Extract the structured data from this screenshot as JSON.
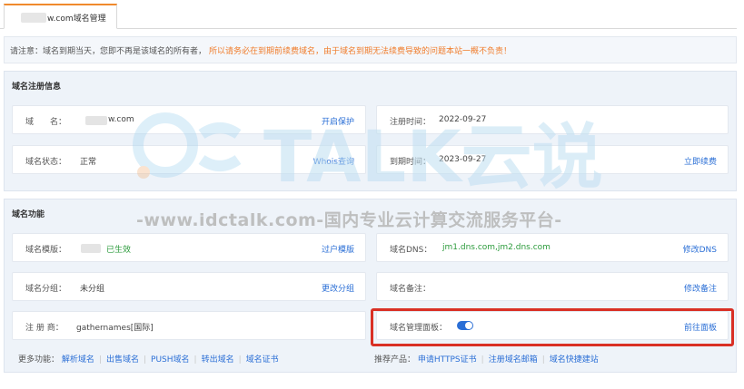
{
  "tab": {
    "label": "w.com域名管理"
  },
  "notice": {
    "text_grey": "请注意：域名到期当天，您即不再是该域名的所有者，",
    "text_orange": "所以请务必在到期前续费域名，由于域名到期无法续费导致的问题本站一概不负责！"
  },
  "registration": {
    "title": "域名注册信息",
    "domain_label": "域　　名：",
    "domain_value": "w.com",
    "domain_action": "开启保护",
    "reg_time_label": "注册时间：",
    "reg_time_value": "2022-09-27",
    "status_label": "域名状态：",
    "status_value": "正常",
    "status_action": "Whois查询",
    "expire_label": "到期时间：",
    "expire_value": "2023-09-27",
    "expire_action": "立即续费"
  },
  "functions": {
    "title": "域名功能",
    "template_label": "域名模版：",
    "template_status": "已生效",
    "template_action": "过户模版",
    "dns_label": "域名DNS：",
    "dns_value": "jm1.dns.com,jm2.dns.com",
    "dns_action": "修改DNS",
    "group_label": "域名分组：",
    "group_value": "未分组",
    "group_action": "更改分组",
    "remark_label": "域名备注：",
    "remark_value": "",
    "remark_action": "修改备注",
    "registrar_label": "注 册 商：",
    "registrar_value": "gathernames[国际]",
    "panel_label": "域名管理面板：",
    "panel_enabled": true,
    "panel_action": "前往面板"
  },
  "more": {
    "label": "更多功能：",
    "links": [
      "解析域名",
      "出售域名",
      "PUSH域名",
      "转出域名",
      "域名证书"
    ]
  },
  "recommend": {
    "label": "推荐产品：",
    "links": [
      "申请HTTPS证书",
      "注册域名邮箱",
      "域名快捷建站"
    ]
  },
  "watermark": {
    "logo_text": "TALK云说",
    "url_text": "-www.idctalk.com-国内专业云计算交流服务平台-"
  },
  "colors": {
    "accent": "#2b6fd6",
    "warning": "#f07c2b",
    "success": "#2c9b3c",
    "highlight": "#d93025"
  }
}
